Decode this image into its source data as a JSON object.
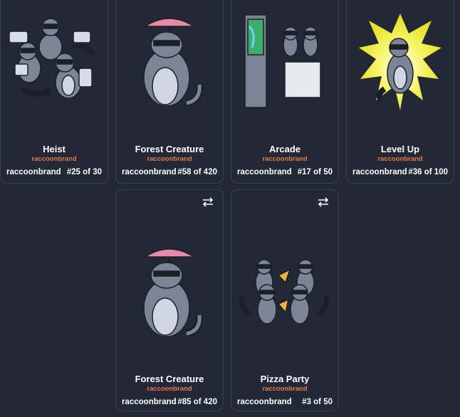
{
  "cards_row1": [
    {
      "title": "Heist",
      "creator": "raccoonbrand",
      "owner": "raccoonbrand",
      "edition": "#25 of 30",
      "art": "heist-raccoons-icon"
    },
    {
      "title": "Forest Creature",
      "creator": "raccoonbrand",
      "owner": "raccoonbrand",
      "edition": "#58 of 420",
      "art": "umbrella-raccoon-icon"
    },
    {
      "title": "Arcade",
      "creator": "raccoonbrand",
      "owner": "raccoonbrand",
      "edition": "#17 of 50",
      "art": "arcade-raccoons-icon"
    },
    {
      "title": "Level Up",
      "creator": "raccoonbrand",
      "owner": "raccoonbrand",
      "edition": "#36 of 100",
      "art": "powerup-raccoon-icon"
    }
  ],
  "cards_row2": [
    {
      "title": "Forest Creature",
      "creator": "raccoonbrand",
      "owner": "raccoonbrand",
      "edition": "#85 of 420",
      "art": "umbrella-raccoon-icon",
      "swap_icon": "swap-arrows-icon"
    },
    {
      "title": "Pizza Party",
      "creator": "raccoonbrand",
      "owner": "raccoonbrand",
      "edition": "#3 of 50",
      "art": "pizza-raccoons-icon",
      "swap_icon": "swap-arrows-icon"
    }
  ],
  "colors": {
    "background": "#222835",
    "card_border": "#3a4152",
    "creator": "#e8774f",
    "raccoon_fur": "#7b8596",
    "raccoon_belly": "#cfd6e2",
    "umbrella": "#e98aa6"
  }
}
